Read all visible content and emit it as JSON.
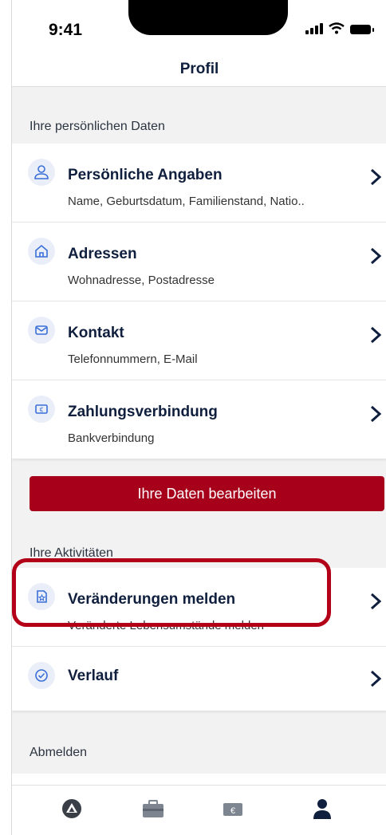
{
  "status_bar": {
    "time": "9:41"
  },
  "header": {
    "title": "Profil"
  },
  "sections": {
    "personal_label": "Ihre persönlichen Daten",
    "activities_label": "Ihre Aktivitäten",
    "logout_label": "Abmelden"
  },
  "personal_items": [
    {
      "title": "Persönliche Angaben",
      "subtitle": "Name, Geburtsdatum, Familienstand, Natio..",
      "icon": "person-icon"
    },
    {
      "title": "Adressen",
      "subtitle": "Wohnadresse, Postadresse",
      "icon": "home-icon"
    },
    {
      "title": "Kontakt",
      "subtitle": "Telefonnummern, E-Mail",
      "icon": "contact-icon"
    },
    {
      "title": "Zahlungsverbindung",
      "subtitle": "Bankverbindung",
      "icon": "euro-card-icon"
    }
  ],
  "edit_button": {
    "label": "Ihre Daten bearbeiten"
  },
  "activity_items": [
    {
      "title": "Veränderungen melden",
      "subtitle": "Veränderte Lebensumstände melden",
      "icon": "report-changes-icon"
    },
    {
      "title": "Verlauf",
      "icon": "check-clock-icon"
    }
  ],
  "tab_bar": {
    "tabs": [
      "home-logo-icon",
      "briefcase-icon",
      "wallet-icon",
      "profile-icon"
    ],
    "active": "profile-icon"
  },
  "colors": {
    "primary_red": "#a6001a",
    "navy": "#0f1f3d",
    "icon_bg": "#e9eef8",
    "highlight": "#b30018"
  }
}
